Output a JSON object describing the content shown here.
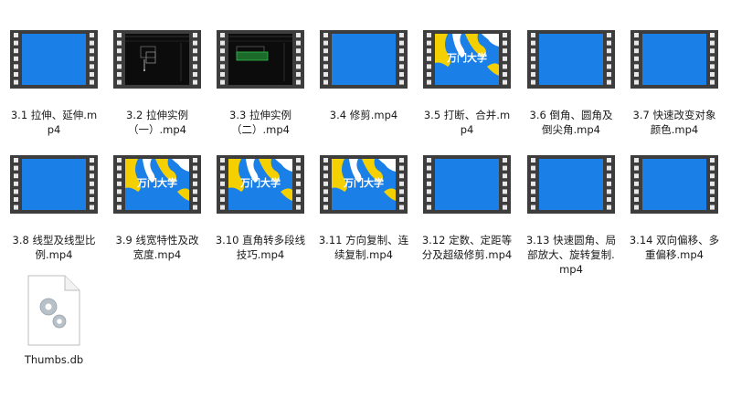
{
  "files": [
    {
      "name": "3.1 拉伸、延伸.mp4",
      "thumb": "blue"
    },
    {
      "name": "3.2 拉伸实例（一）.mp4",
      "thumb": "cad-dark"
    },
    {
      "name": "3.3 拉伸实例（二）.mp4",
      "thumb": "cad-green"
    },
    {
      "name": "3.4 修剪.mp4",
      "thumb": "blue"
    },
    {
      "name": "3.5 打断、合并.mp4",
      "thumb": "logo"
    },
    {
      "name": "3.6 倒角、圆角及倒尖角.mp4",
      "thumb": "blue"
    },
    {
      "name": "3.7 快速改变对象颜色.mp4",
      "thumb": "blue"
    },
    {
      "name": "3.8 线型及线型比例.mp4",
      "thumb": "blue"
    },
    {
      "name": "3.9 线宽特性及改宽度.mp4",
      "thumb": "logo"
    },
    {
      "name": "3.10 直角转多段线技巧.mp4",
      "thumb": "logo"
    },
    {
      "name": "3.11 方向复制、连续复制.mp4",
      "thumb": "logo"
    },
    {
      "name": "3.12 定数、定距等分及超级修剪.mp4",
      "thumb": "blue"
    },
    {
      "name": "3.13 快速圆角、局部放大、旋转复制.mp4",
      "thumb": "blue"
    },
    {
      "name": "3.14 双向偏移、多重偏移.mp4",
      "thumb": "blue"
    },
    {
      "name": "Thumbs.db",
      "thumb": "file"
    }
  ],
  "logo_text": "万门大学",
  "colors": {
    "film": "#3d3d3d",
    "hole": "#e8e8e8",
    "blue_screen": "#1a7fe6",
    "logo_bg": "#1a7fe6",
    "logo_yellow": "#f5d000",
    "cad_bg": "#0c0c0c",
    "file_gray": "#f2f2f2"
  },
  "icons": {
    "video": "film-strip-icon",
    "file": "gear-file-icon"
  }
}
